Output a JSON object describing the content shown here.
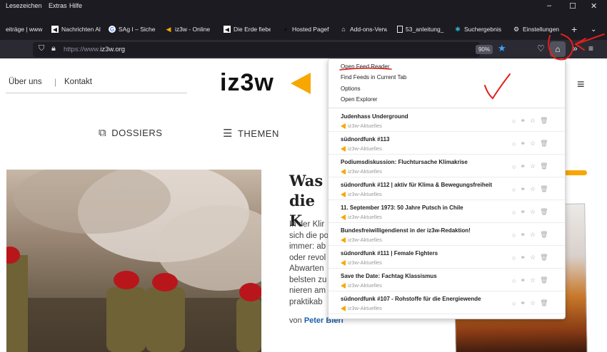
{
  "menubar": {
    "items": [
      "Lesezeichen",
      "Extras",
      "Hilfe"
    ],
    "minimize": "–",
    "maximize": "☐",
    "close": "✕"
  },
  "bookmarks": [
    {
      "label": "eiträge | www",
      "icon": "no-icon"
    },
    {
      "label": "Nachrichten Al",
      "icon": "news-icon"
    },
    {
      "label": "SAg I – Sichert",
      "icon": "google-icon"
    },
    {
      "label": "iz3w - Online",
      "icon": "iz3w-icon"
    },
    {
      "label": "Die Erde fieber",
      "icon": "news-icon"
    },
    {
      "label": "Hosted Pagefi",
      "icon": "dot-icon"
    },
    {
      "label": "Add-ons-Verw",
      "icon": "puzzle-icon"
    },
    {
      "label": "53_anleitung_",
      "icon": "file-icon"
    },
    {
      "label": "Suchergebnis",
      "icon": "paw-icon"
    },
    {
      "label": "Einstellungen",
      "icon": "gear-icon"
    }
  ],
  "toolbar": {
    "url_prefix": "https://www.",
    "url_domain": "iz3w.org",
    "zoom": "90%",
    "more_tools": "»",
    "menu": "≡"
  },
  "page": {
    "nav": [
      "Über uns",
      "Kontakt"
    ],
    "nav_separator": "|",
    "logo": "iz3w",
    "categories": [
      {
        "label": "DOSSIERS",
        "icon": "dossier-icon"
      },
      {
        "label": "THEMEN",
        "icon": "list-icon"
      }
    ],
    "article_title_lines": [
      "Was",
      "die K"
    ],
    "article_body_lines": [
      "In der Klir",
      "sich die po",
      "immer: ab",
      "oder revol",
      "Abwarten",
      "belsten zu",
      "nieren am",
      "praktikab"
    ],
    "byline_prefix": "von",
    "byline_author": "Peter Bierl"
  },
  "popup": {
    "actions": [
      "Open Feed Reader",
      "Find Feeds in Current Tab",
      "Options",
      "Open Explorer"
    ],
    "feeds": [
      {
        "title": "Judenhass Underground",
        "source": "iz3w-Aktuelles"
      },
      {
        "title": "südnordfunk #113",
        "source": "iz3w-Aktuelles"
      },
      {
        "title": "Podiumsdiskussion: Fluchtursache Klimakrise",
        "source": "iz3w-Aktuelles"
      },
      {
        "title": "südnordfunk #112 | aktiv für Klima & Bewegungsfreiheit",
        "source": "iz3w-Aktuelles"
      },
      {
        "title": "11. September 1973: 50 Jahre Putsch in Chile",
        "source": "iz3w-Aktuelles"
      },
      {
        "title": "Bundesfreiwilligendienst in der iz3w-Redaktion!",
        "source": "iz3w-Aktuelles"
      },
      {
        "title": "südnordfunk #111 | Female Fighters",
        "source": "iz3w-Aktuelles"
      },
      {
        "title": "Save the Date: Fachtag Klassismus",
        "source": "iz3w-Aktuelles"
      },
      {
        "title": "südnordfunk #107 - Rohstoffe für die Energiewende",
        "source": "iz3w-Aktuelles"
      }
    ]
  },
  "colors": {
    "accent": "#f7a700",
    "chrome_dark": "#1c1b22",
    "toolbar": "#2b2a33",
    "annotation": "#e0201a",
    "author_link": "#1a5fa8"
  }
}
